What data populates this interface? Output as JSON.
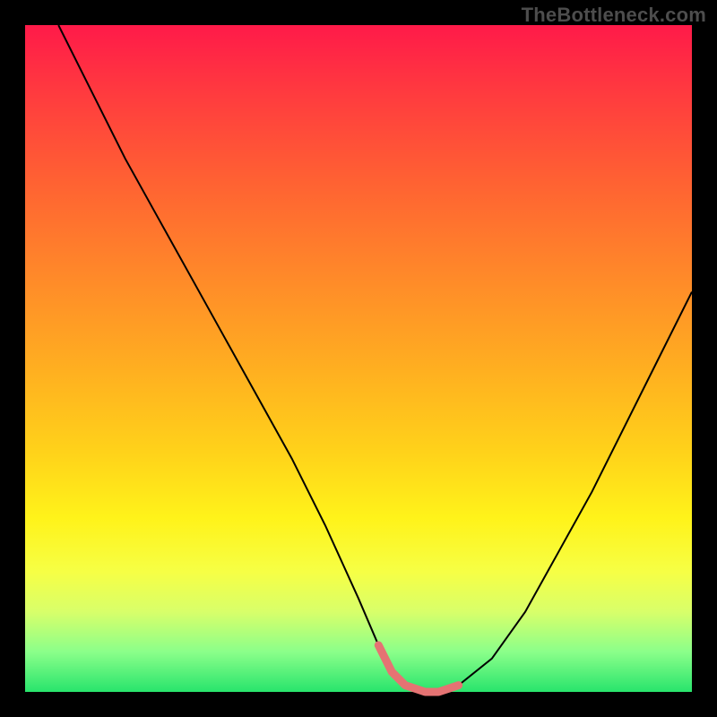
{
  "watermark": "TheBottleneck.com",
  "chart_data": {
    "type": "line",
    "title": "",
    "xlabel": "",
    "ylabel": "",
    "xlim": [
      0,
      100
    ],
    "ylim": [
      0,
      100
    ],
    "gradient_bands": [
      {
        "name": "red",
        "y_pct": 0
      },
      {
        "name": "orange",
        "y_pct": 40
      },
      {
        "name": "yellow",
        "y_pct": 75
      },
      {
        "name": "green",
        "y_pct": 100
      }
    ],
    "series": [
      {
        "name": "bottleneck-curve",
        "color": "#000000",
        "stroke_width": 2,
        "x": [
          5,
          10,
          15,
          20,
          25,
          30,
          35,
          40,
          45,
          50,
          53,
          55,
          57,
          60,
          62,
          65,
          70,
          75,
          80,
          85,
          90,
          95,
          100
        ],
        "y": [
          100,
          90,
          80,
          71,
          62,
          53,
          44,
          35,
          25,
          14,
          7,
          3,
          1,
          0,
          0,
          1,
          5,
          12,
          21,
          30,
          40,
          50,
          60
        ]
      },
      {
        "name": "optimal-flat-segment",
        "color": "#e57373",
        "stroke_width": 9,
        "linecap": "round",
        "x": [
          53,
          55,
          57,
          60,
          62,
          65
        ],
        "y": [
          7,
          3,
          1,
          0,
          0,
          1
        ]
      }
    ]
  }
}
